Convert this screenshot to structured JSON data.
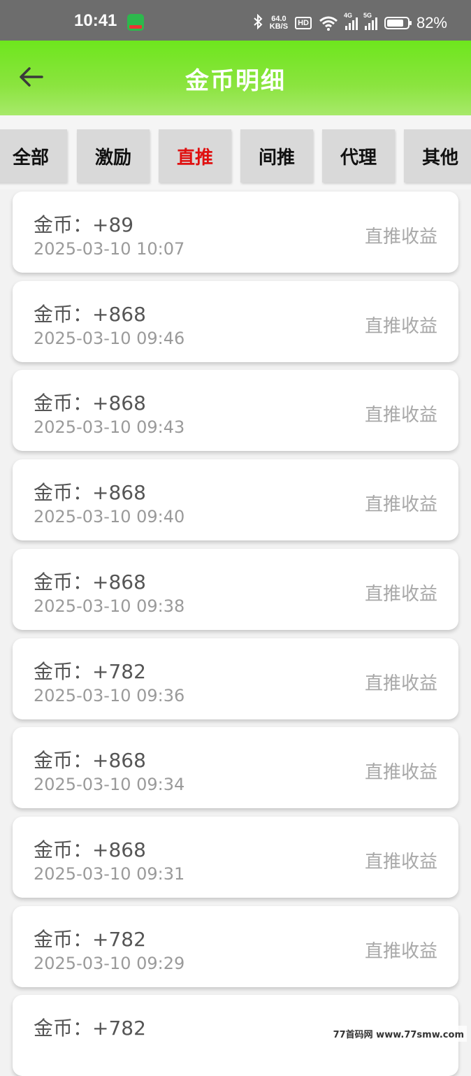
{
  "status_bar": {
    "time": "10:41",
    "speed_value": "64.0",
    "speed_unit": "KB/S",
    "hd": "HD",
    "sig1_label": "4G",
    "sig2_label": "5G",
    "battery_level": 0.82,
    "battery": "82%"
  },
  "header": {
    "back_icon": "arrow-left-icon",
    "title": "金币明细"
  },
  "tabs": [
    {
      "label": "全部",
      "active": false
    },
    {
      "label": "激励",
      "active": false
    },
    {
      "label": "直推",
      "active": true
    },
    {
      "label": "间推",
      "active": false
    },
    {
      "label": "代理",
      "active": false
    },
    {
      "label": "其他",
      "active": false
    }
  ],
  "records": [
    {
      "coin": "金币：+89",
      "date": "2025-03-10 10:07",
      "type": "直推收益"
    },
    {
      "coin": "金币：+868",
      "date": "2025-03-10 09:46",
      "type": "直推收益"
    },
    {
      "coin": "金币：+868",
      "date": "2025-03-10 09:43",
      "type": "直推收益"
    },
    {
      "coin": "金币：+868",
      "date": "2025-03-10 09:40",
      "type": "直推收益"
    },
    {
      "coin": "金币：+868",
      "date": "2025-03-10 09:38",
      "type": "直推收益"
    },
    {
      "coin": "金币：+782",
      "date": "2025-03-10 09:36",
      "type": "直推收益"
    },
    {
      "coin": "金币：+868",
      "date": "2025-03-10 09:34",
      "type": "直推收益"
    },
    {
      "coin": "金币：+868",
      "date": "2025-03-10 09:31",
      "type": "直推收益"
    },
    {
      "coin": "金币：+782",
      "date": "2025-03-10 09:29",
      "type": "直推收益"
    },
    {
      "coin": "金币：+782",
      "date": "",
      "type": ""
    }
  ],
  "watermark": "77首码网 www.77smw.com",
  "colors": {
    "header_green": "#6ee61d",
    "active_tab": "#e01010"
  }
}
